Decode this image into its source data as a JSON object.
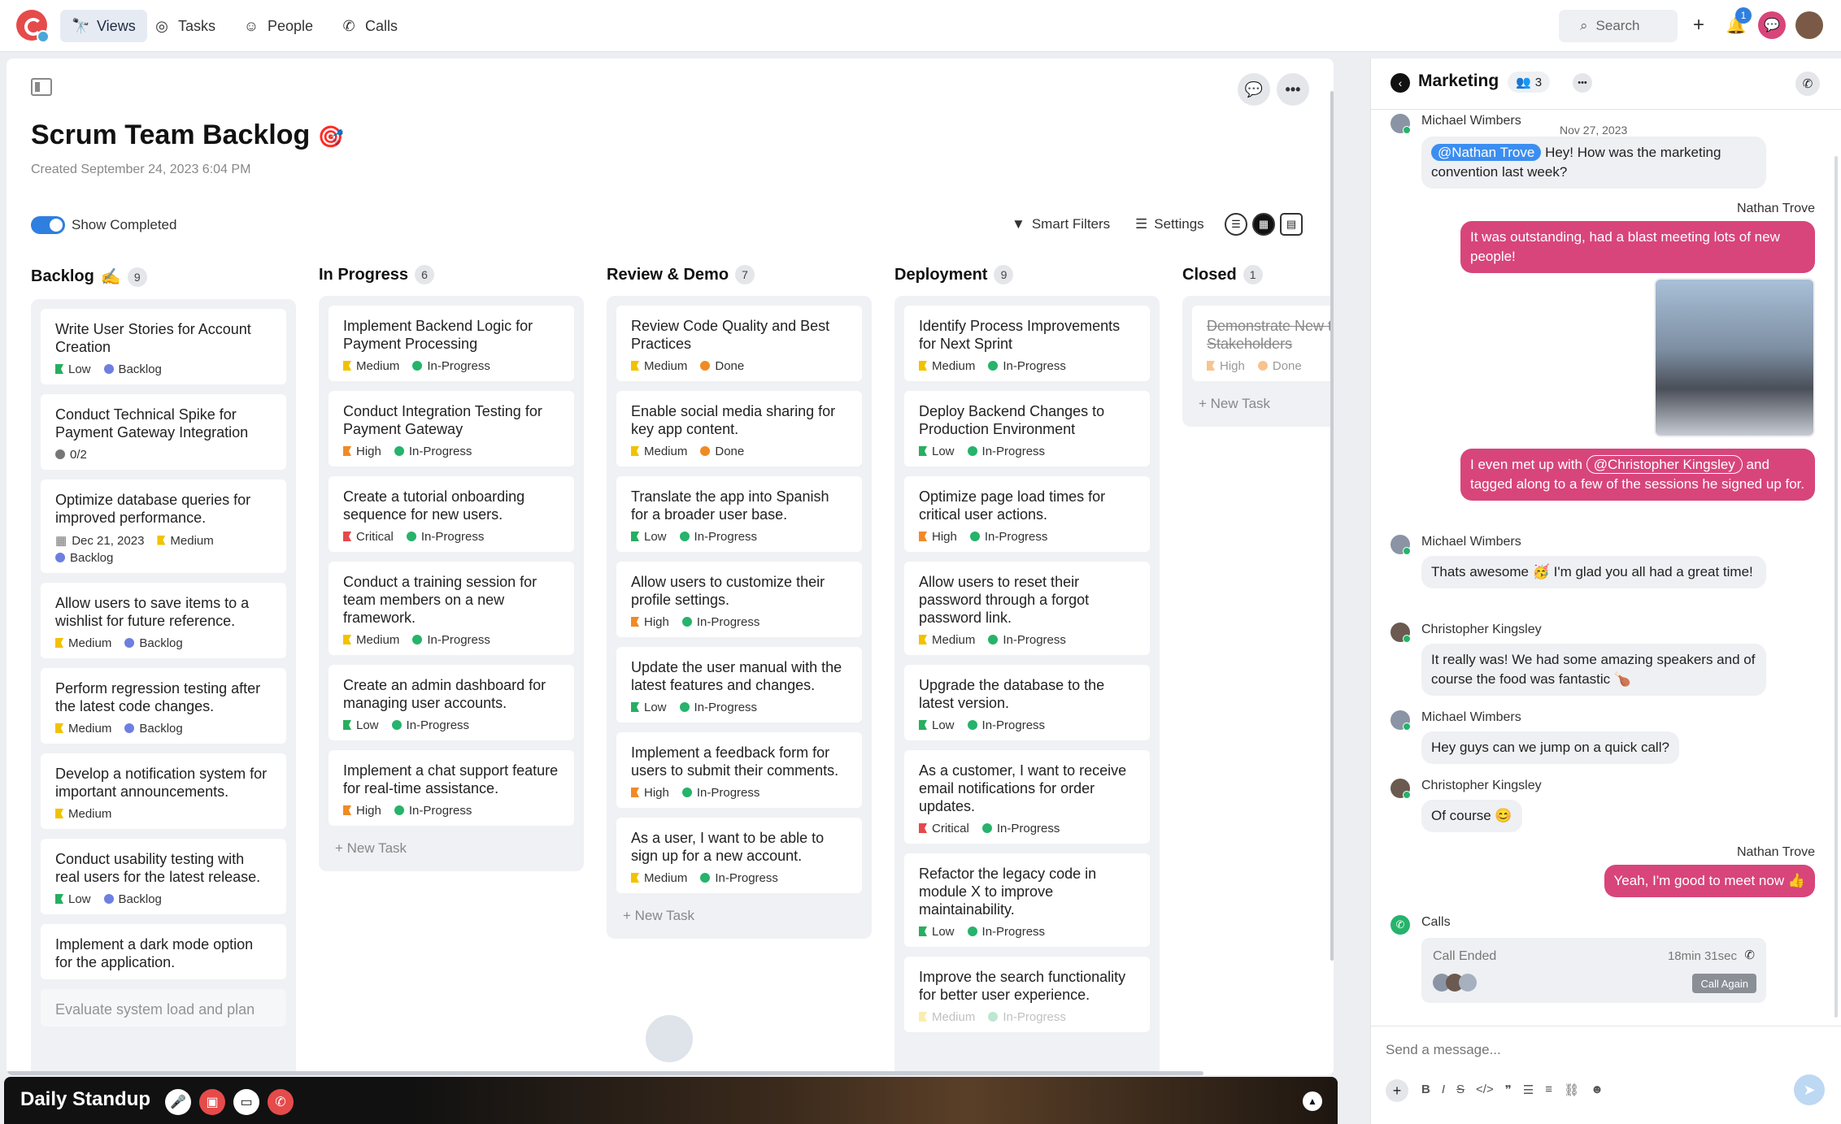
{
  "nav": {
    "views": "Views",
    "tasks": "Tasks",
    "people": "People",
    "calls": "Calls",
    "search": "Search",
    "notif_count": "1"
  },
  "board": {
    "title": "Scrum Team Backlog",
    "title_emoji": "🎯",
    "created": "Created September 24, 2023 6:04 PM",
    "show_completed": "Show Completed",
    "smart_filters": "Smart Filters",
    "settings": "Settings"
  },
  "columns": [
    {
      "name": "Backlog",
      "emoji": "✍️",
      "count": "9",
      "cards": [
        {
          "title": "Write User Stories for Account Creation",
          "priority": "Low",
          "status": "Backlog"
        },
        {
          "title": "Conduct Technical Spike for Payment Gateway Integration",
          "progress": "0/2"
        },
        {
          "title": "Optimize database queries for improved performance.",
          "date": "Dec 21, 2023",
          "priority": "Medium",
          "status": "Backlog"
        },
        {
          "title": "Allow users to save items to a wishlist for future reference.",
          "priority": "Medium",
          "status": "Backlog"
        },
        {
          "title": "Perform regression testing after the latest code changes.",
          "priority": "Medium",
          "status": "Backlog"
        },
        {
          "title": "Develop a notification system for important announcements.",
          "priority": "Medium"
        },
        {
          "title": "Conduct usability testing with real users for the latest release.",
          "priority": "Low",
          "status": "Backlog"
        },
        {
          "title": "Implement a dark mode option for the application."
        },
        {
          "title": "Evaluate system load and plan"
        }
      ]
    },
    {
      "name": "In Progress",
      "count": "6",
      "cards": [
        {
          "title": "Implement Backend Logic for Payment Processing",
          "priority": "Medium",
          "status": "In-Progress"
        },
        {
          "title": "Conduct Integration Testing for Payment Gateway",
          "priority": "High",
          "status": "In-Progress"
        },
        {
          "title": "Create a tutorial onboarding sequence for new users.",
          "priority": "Critical",
          "status": "In-Progress"
        },
        {
          "title": "Conduct a training session for team members on a new framework.",
          "priority": "Medium",
          "status": "In-Progress"
        },
        {
          "title": "Create an admin dashboard for managing user accounts.",
          "priority": "Low",
          "status": "In-Progress"
        },
        {
          "title": "Implement a chat support feature for real-time assistance.",
          "priority": "High",
          "status": "In-Progress"
        }
      ],
      "new_task": "New Task"
    },
    {
      "name": "Review & Demo",
      "count": "7",
      "cards": [
        {
          "title": "Review Code Quality and Best Practices",
          "priority": "Medium",
          "status": "Done"
        },
        {
          "title": "Enable social media sharing for key app content.",
          "priority": "Medium",
          "status": "Done"
        },
        {
          "title": "Translate the app into Spanish for a broader user base.",
          "priority": "Low",
          "status": "In-Progress"
        },
        {
          "title": "Allow users to customize their profile settings.",
          "priority": "High",
          "status": "In-Progress"
        },
        {
          "title": "Update the user manual with the latest features and changes.",
          "priority": "Low",
          "status": "In-Progress"
        },
        {
          "title": "Implement a feedback form for users to submit their comments.",
          "priority": "High",
          "status": "In-Progress"
        },
        {
          "title": "As a user, I want to be able to sign up for a new account.",
          "priority": "Medium",
          "status": "In-Progress"
        }
      ],
      "new_task": "New Task"
    },
    {
      "name": "Deployment",
      "count": "9",
      "cards": [
        {
          "title": "Identify Process Improvements for Next Sprint",
          "priority": "Medium",
          "status": "In-Progress"
        },
        {
          "title": "Deploy Backend Changes to Production Environment",
          "priority": "Low",
          "status": "In-Progress"
        },
        {
          "title": "Optimize page load times for critical user actions.",
          "priority": "High",
          "status": "In-Progress"
        },
        {
          "title": "Allow users to reset their password through a forgot password link.",
          "priority": "Medium",
          "status": "In-Progress"
        },
        {
          "title": "Upgrade the database to the latest version.",
          "priority": "Low",
          "status": "In-Progress"
        },
        {
          "title": "As a customer, I want to receive email notifications for order updates.",
          "priority": "Critical",
          "status": "In-Progress"
        },
        {
          "title": "Refactor the legacy code in module X to improve maintainability.",
          "priority": "Low",
          "status": "In-Progress"
        },
        {
          "title": "Improve the search functionality for better user experience.",
          "priority": "Medium",
          "status": "In-Progress"
        }
      ]
    },
    {
      "name": "Closed",
      "count": "1",
      "cards": [
        {
          "title": "Demonstrate New to Stakeholders",
          "priority": "High",
          "status": "Done"
        }
      ],
      "new_task": "New Task"
    }
  ],
  "colors": {
    "Low": "#27ae60",
    "Medium": "#f2c200",
    "High": "#f08a24",
    "Critical": "#e5484d",
    "Backlog": "#6d7fe0",
    "In-Progress": "#26b36b",
    "Done": "#f08a24"
  },
  "call": {
    "title": "Daily Standup"
  },
  "chat": {
    "channel": "Marketing",
    "member_count": "3",
    "date": "Nov 27, 2023",
    "messages": [
      {
        "sender": "Michael Wimbers",
        "mention": "@Nathan Trove",
        "text": "Hey! How was the marketing convention last week?"
      },
      {
        "sender": "Nathan Trove",
        "text": "It was outstanding, had a blast meeting lots of new people!"
      },
      {
        "text_a": "I even met up with",
        "mention": "@Christopher Kingsley",
        "text_b": "and tagged along to a few of the sessions he signed up for."
      },
      {
        "sender": "Michael Wimbers",
        "text": "Thats awesome 🥳 I'm glad you all had a great time!"
      },
      {
        "sender": "Christopher Kingsley",
        "text": "It really was! We had some amazing speakers and of course the food was fantastic 🍗"
      },
      {
        "sender": "Michael Wimbers",
        "text": "Hey guys can we jump on a quick call?"
      },
      {
        "sender": "Christopher Kingsley",
        "text": "Of course 😊"
      },
      {
        "sender": "Nathan Trove",
        "text": "Yeah, I'm good to meet now 👍"
      }
    ],
    "calls": {
      "label": "Calls",
      "status": "Call Ended",
      "duration": "18min 31sec",
      "call_again": "Call Again"
    },
    "composer_placeholder": "Send a message..."
  }
}
